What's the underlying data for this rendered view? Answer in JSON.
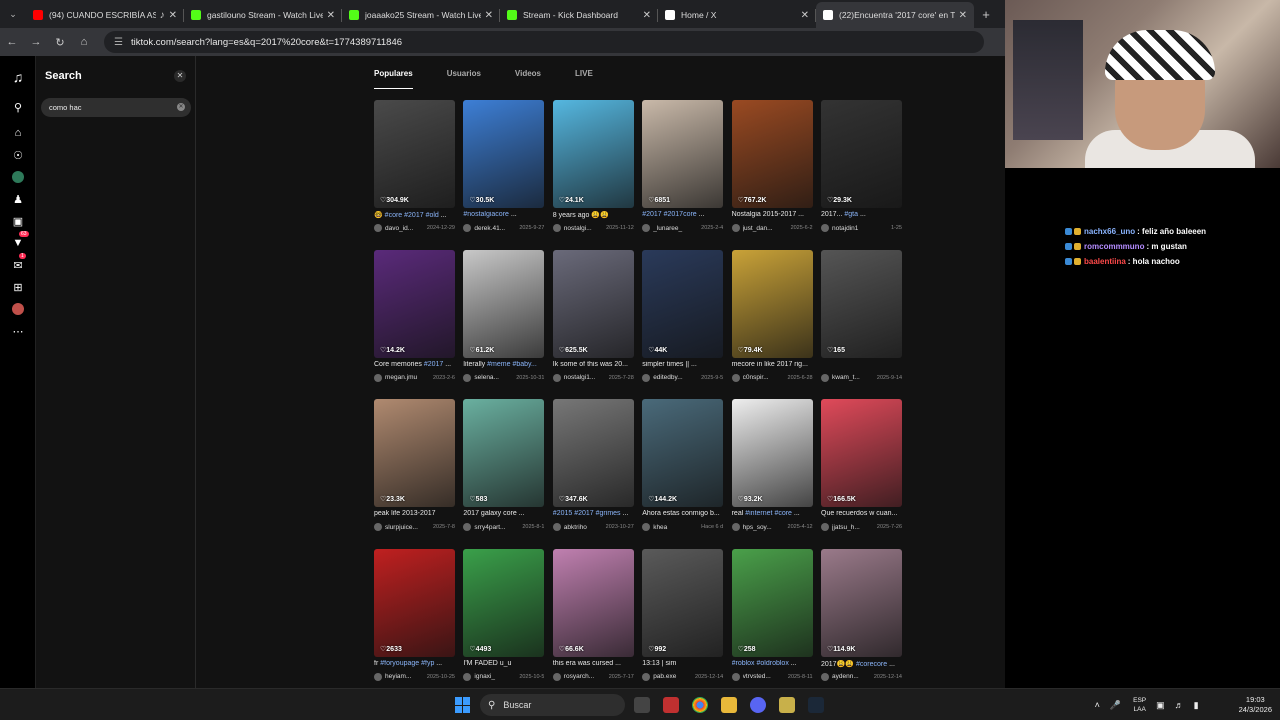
{
  "browser": {
    "tabs": [
      {
        "title": "(94) CUANDO ESCRIBÍA AS",
        "favicon_color": "#ff0000",
        "audio": true
      },
      {
        "title": "gastilouno Stream - Watch Live",
        "favicon_color": "#53fc18"
      },
      {
        "title": "joaaako25 Stream - Watch Live",
        "favicon_color": "#53fc18"
      },
      {
        "title": "Stream - Kick Dashboard",
        "favicon_color": "#53fc18"
      },
      {
        "title": "Home / X",
        "favicon_color": "#ffffff"
      },
      {
        "title": "(22)Encuentra '2017 core' en Ti",
        "favicon_color": "#ffffff",
        "active": true
      }
    ],
    "url": "tiktok.com/search?lang=es&q=2017%20core&t=1774389711846"
  },
  "tiktok": {
    "search_title": "Search",
    "search_input": "como hac",
    "result_tabs": [
      "Populares",
      "Usuarios",
      "Videos",
      "LIVE"
    ],
    "nav_badges": {
      "inbox": "63",
      "messages": "1"
    },
    "videos": [
      {
        "views": "304.9K",
        "title": "🤓 #core #2017 #old ...",
        "user": "davo_id...",
        "date": "2024-12-29",
        "color": "#4a4a4a"
      },
      {
        "views": "30.5K",
        "title": "#nostalgiacore ...",
        "user": "derek.41...",
        "date": "2025-9-27",
        "color": "#3d7fd6"
      },
      {
        "views": "24.1K",
        "title": "8 years ago 😩😩",
        "user": "nostalgi...",
        "date": "2025-11-12",
        "color": "#55b7e0"
      },
      {
        "views": "6851",
        "title": "#2017 #2017core ...",
        "user": "_lunaree_",
        "date": "2025-2-4",
        "color": "#c9b9a9"
      },
      {
        "views": "767.2K",
        "title": "Nostalgia 2015-2017 ...",
        "user": "just_dan...",
        "date": "2025-6-2",
        "color": "#9a4a22"
      },
      {
        "views": "29.3K",
        "title": "2017... #gta ...",
        "user": "notajdin1",
        "date": "1-25",
        "color": "#333333"
      },
      {
        "views": "14.2K",
        "title": "Core memories #2017 ...",
        "user": "megan.jmu",
        "date": "2023-2-6",
        "color": "#5a2a7a"
      },
      {
        "views": "61.2K",
        "title": "literally #meme #baby...",
        "user": "selena...",
        "date": "2025-10-31",
        "color": "#c8c8c8"
      },
      {
        "views": "625.5K",
        "title": "Ik some of this was 20...",
        "user": "nostalgi1...",
        "date": "2025-7-28",
        "color": "#6a6a7a"
      },
      {
        "views": "44K",
        "title": "simpler times || ...",
        "user": "editedby...",
        "date": "2025-9-5",
        "color": "#2a3a5a"
      },
      {
        "views": "79.4K",
        "title": "mecore in like 2017 rig...",
        "user": "c0nspir...",
        "date": "2025-6-28",
        "color": "#c9a238"
      },
      {
        "views": "165",
        "title": "",
        "user": "kwam_t...",
        "date": "2025-9-14",
        "color": "#555555"
      },
      {
        "views": "23.3K",
        "title": "peak life 2013-2017",
        "user": "slurpjuice...",
        "date": "2025-7-8",
        "color": "#b08a70"
      },
      {
        "views": "583",
        "title": "2017 galaxy core ...",
        "user": "srry4part...",
        "date": "2025-8-1",
        "color": "#6ab0a0"
      },
      {
        "views": "347.6K",
        "title": "#2015 #2017 #grimes ...",
        "user": "abktriho",
        "date": "2023-10-27",
        "color": "#777777"
      },
      {
        "views": "144.2K",
        "title": "Ahora estas conmigo b...",
        "user": "khea",
        "date": "Hace 6 d",
        "color": "#4a6a7a"
      },
      {
        "views": "93.2K",
        "title": "real #internet #core ...",
        "user": "hps_soy...",
        "date": "2025-4-12",
        "color": "#eeeeee"
      },
      {
        "views": "166.5K",
        "title": "Que recuerdos w cuan...",
        "user": "jjatsu_h...",
        "date": "2025-7-26",
        "color": "#e04a5a"
      },
      {
        "views": "2633",
        "title": "fr #foryoupage #fyp ...",
        "user": "heyiam...",
        "date": "2025-10-25",
        "color": "#c02020"
      },
      {
        "views": "4493",
        "title": "I'M FADED u_u",
        "user": "ignaxi_",
        "date": "2025-10-5",
        "color": "#3aa04a"
      },
      {
        "views": "66.6K",
        "title": "this era was cursed ...",
        "user": "rosyarch...",
        "date": "2025-7-17",
        "color": "#c080b0"
      },
      {
        "views": "992",
        "title": "13:13 | sim",
        "user": "pab.exe",
        "date": "2025-12-14",
        "color": "#5a5a5a"
      },
      {
        "views": "258",
        "title": "#roblox #oldroblox ...",
        "user": "vtrvsted...",
        "date": "2025-8-11",
        "color": "#4aa04a"
      },
      {
        "views": "114.9K",
        "title": "2017😩😩 #corecore ...",
        "user": "aydenn...",
        "date": "2025-12-14",
        "color": "#9a7a8a"
      }
    ]
  },
  "chat": [
    {
      "name": "nachx66_uno",
      "name_color": "#8ab4ff",
      "message": ": feliz año baleeen"
    },
    {
      "name": "romcommmuno",
      "name_color": "#b48cff",
      "message": ": m gustan"
    },
    {
      "name": "baalentiina",
      "name_color": "#ff4a4a",
      "message": ": hola nachoo"
    }
  ],
  "taskbar": {
    "search_label": "Buscar",
    "lang_top": "ESP",
    "lang_bottom": "LAA",
    "time": "19:03",
    "date": "24/3/2026"
  }
}
